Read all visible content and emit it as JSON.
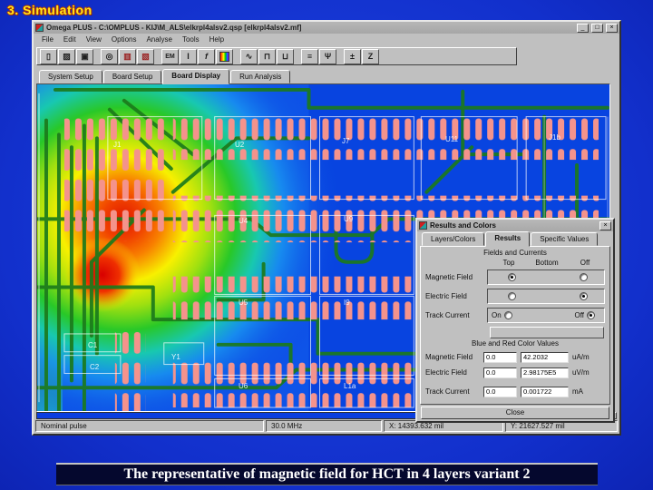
{
  "slide": {
    "title": "3. Simulation",
    "caption": "The representative of magnetic field for HCT in 4 layers variant 2"
  },
  "window": {
    "title": "Omega PLUS - C:\\OMPLUS - KIJ\\M_ALS\\elkrpl4alsv2.qsp [elkrpl4alsv2.mf]",
    "controls": {
      "minimize": "_",
      "maximize": "□",
      "close": "×"
    },
    "menu": [
      "File",
      "Edit",
      "View",
      "Options",
      "Analyse",
      "Tools",
      "Help"
    ],
    "toolbar": [
      {
        "name": "new-file",
        "glyph": "▯",
        "group": 0
      },
      {
        "name": "open-folder",
        "glyph": "▨",
        "group": 0
      },
      {
        "name": "save",
        "glyph": "▣",
        "group": 0
      },
      {
        "name": "board-view",
        "glyph": "◎",
        "group": 1
      },
      {
        "name": "report",
        "glyph": "▥",
        "group": 1,
        "color": "#992020"
      },
      {
        "name": "component",
        "glyph": "▧",
        "group": 1,
        "color": "#992020"
      },
      {
        "name": "em-field",
        "glyph": "EM",
        "group": 2
      },
      {
        "name": "current",
        "glyph": "I",
        "group": 2
      },
      {
        "name": "frequency",
        "glyph": "f",
        "group": 2
      },
      {
        "name": "spectrum",
        "glyph": "",
        "group": 2,
        "rainbow": true
      },
      {
        "name": "waveform",
        "glyph": "∿",
        "group": 3
      },
      {
        "name": "plot-upper",
        "glyph": "⊓",
        "group": 3
      },
      {
        "name": "plot-lower",
        "glyph": "⊔",
        "group": 3
      },
      {
        "name": "list",
        "glyph": "≡",
        "group": 4
      },
      {
        "name": "net",
        "glyph": "Ψ",
        "group": 4
      },
      {
        "name": "tolerance",
        "glyph": "±",
        "group": 5
      },
      {
        "name": "zoom",
        "glyph": "Z",
        "group": 5
      }
    ],
    "tabs": [
      {
        "label": "System Setup",
        "active": false
      },
      {
        "label": "Board Setup",
        "active": false
      },
      {
        "label": "Board Display",
        "active": true
      },
      {
        "label": "Run Analysis",
        "active": false
      }
    ]
  },
  "board": {
    "labels": [
      "J1",
      "U2",
      "J7",
      "U11",
      "J1b",
      "U4",
      "U9",
      "U5",
      "I9",
      "U6",
      "L1a",
      "C1",
      "C2",
      "Y1"
    ]
  },
  "dialog": {
    "title": "Results and Colors",
    "close_glyph": "×",
    "tabs": [
      {
        "label": "Layers/Colors",
        "active": false
      },
      {
        "label": "Results",
        "active": true
      },
      {
        "label": "Specific Values",
        "active": false
      }
    ],
    "fields_section": "Fields and Currents",
    "columns": [
      "Top",
      "Bottom",
      "Off"
    ],
    "radio_rows": [
      {
        "label": "Magnetic Field",
        "selected": "top"
      },
      {
        "label": "Electric Field",
        "selected": "off"
      },
      {
        "label": "Track Current",
        "on_label": "On",
        "off_label": "Off",
        "selected": "off"
      }
    ],
    "values_section": "Blue and Red Color Values",
    "value_rows": [
      {
        "label": "Magnetic Field",
        "blue": "0.0",
        "red": "42.2032",
        "unit": "uA/m"
      },
      {
        "label": "Electric Field",
        "blue": "0.0",
        "red": "2.98175E5",
        "unit": "uV/m"
      },
      {
        "label": "Track Current",
        "blue": "0.0",
        "red": "0.001722",
        "unit": "mA"
      }
    ],
    "close_label": "Close"
  },
  "statusbar": {
    "mode": "Nominal pulse",
    "frequency": "30.0 MHz",
    "x_pos": "X: 14393.632 mil",
    "y_pos": "Y: 21627.527 mil"
  },
  "colors": {
    "slide_bg": "#1230cc",
    "title_yellow": "#ffe61c",
    "board_blue": "#0844e0",
    "trace_green": "#1c7a1c",
    "pad_salmon": "#f4938c",
    "caption_bg": "#05082e",
    "window_gray": "#c0c0c0"
  }
}
